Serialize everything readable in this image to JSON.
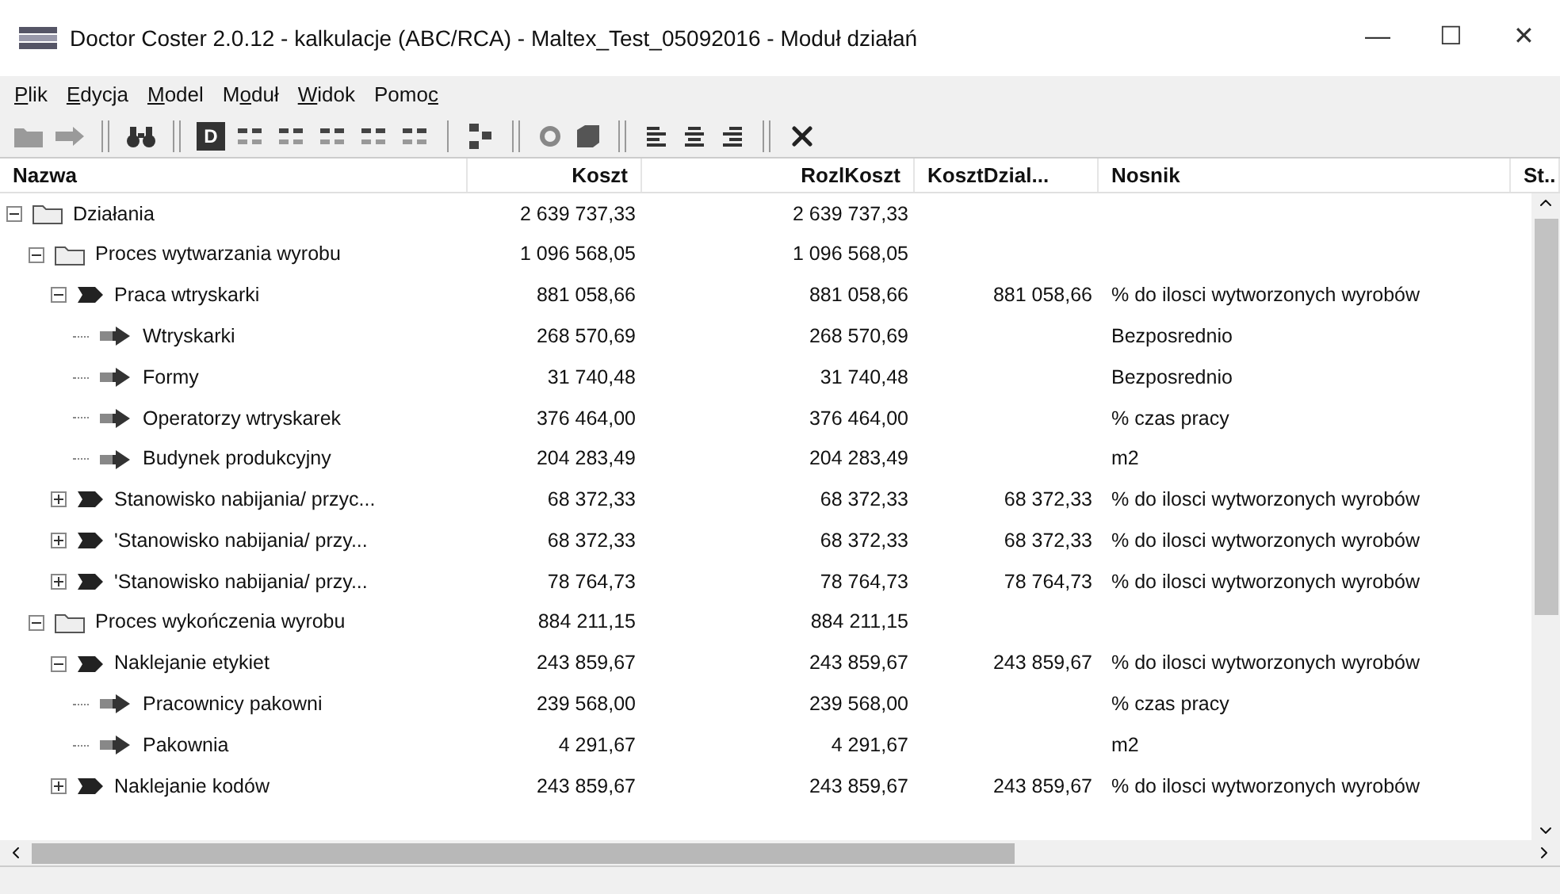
{
  "window": {
    "title": "Doctor Coster 2.0.12 - kalkulacje (ABC/RCA) - Maltex_Test_05092016 - Moduł działań",
    "buttons": [
      "—",
      "☐",
      "✕"
    ]
  },
  "menu": [
    {
      "key": "P",
      "post": "lik"
    },
    {
      "key": "E",
      "post": "dycja"
    },
    {
      "key": "M",
      "post": "odel"
    },
    {
      "pre": "M",
      "key": "o",
      "post": "duł"
    },
    {
      "key": "W",
      "post": "idok"
    },
    {
      "pre": "Pomo",
      "key": "c"
    }
  ],
  "toolbar": [
    {
      "kind": "folder",
      "disabled": true
    },
    {
      "kind": "arrow",
      "disabled": true
    },
    {
      "kind": "sep"
    },
    {
      "kind": "binoculars",
      "disabled": false
    },
    {
      "kind": "sep"
    },
    {
      "kind": "letter",
      "label": "D"
    },
    {
      "kind": "grid"
    },
    {
      "kind": "grid"
    },
    {
      "kind": "grid"
    },
    {
      "kind": "grid"
    },
    {
      "kind": "grid"
    },
    {
      "kind": "sep1"
    },
    {
      "kind": "tree"
    },
    {
      "kind": "sep"
    },
    {
      "kind": "gear"
    },
    {
      "kind": "cube"
    },
    {
      "kind": "sep"
    },
    {
      "kind": "align-left"
    },
    {
      "kind": "align-center"
    },
    {
      "kind": "align-right"
    },
    {
      "kind": "sep"
    },
    {
      "kind": "delete"
    }
  ],
  "table": {
    "columns": [
      "Nazwa",
      "Koszt",
      "RozlKoszt",
      "KosztDzial...",
      "Nosnik",
      "St.."
    ],
    "rows": [
      {
        "kind": "folder",
        "expanded": true,
        "name": "Działania",
        "koszt": "2 639 737,33",
        "rozl": "2 639 737,33",
        "children": [
          {
            "kind": "folder",
            "expanded": true,
            "name": "Proces wytwarzania wyrobu",
            "koszt": "1 096 568,05",
            "rozl": "1 096 568,05",
            "children": [
              {
                "kind": "activity",
                "expanded": true,
                "name": "Praca wtryskarki",
                "koszt": "881 058,66",
                "rozl": "881 058,66",
                "dzial": "881 058,66",
                "nosnik": "% do ilosci wytworzonych wyrobów",
                "children": [
                  {
                    "kind": "resource",
                    "name": "Wtryskarki",
                    "koszt": "268 570,69",
                    "rozl": "268 570,69",
                    "nosnik": "Bezposrednio"
                  },
                  {
                    "kind": "resource",
                    "name": "Formy",
                    "koszt": "31 740,48",
                    "rozl": "31 740,48",
                    "nosnik": "Bezposrednio"
                  },
                  {
                    "kind": "resource",
                    "name": "Operatorzy wtryskarek",
                    "koszt": "376 464,00",
                    "rozl": "376 464,00",
                    "nosnik": "% czas pracy"
                  },
                  {
                    "kind": "resource",
                    "name": "Budynek produkcyjny",
                    "koszt": "204 283,49",
                    "rozl": "204 283,49",
                    "nosnik": "m2"
                  }
                ]
              },
              {
                "kind": "activity",
                "expanded": false,
                "name": "Stanowisko nabijania/ przyc...",
                "koszt": "68 372,33",
                "rozl": "68 372,33",
                "dzial": "68 372,33",
                "nosnik": "% do ilosci wytworzonych wyrobów"
              },
              {
                "kind": "activity",
                "expanded": false,
                "name": "'Stanowisko nabijania/ przy...",
                "koszt": "68 372,33",
                "rozl": "68 372,33",
                "dzial": "68 372,33",
                "nosnik": "% do ilosci wytworzonych wyrobów"
              },
              {
                "kind": "activity",
                "expanded": false,
                "name": "'Stanowisko nabijania/ przy...",
                "koszt": "78 764,73",
                "rozl": "78 764,73",
                "dzial": "78 764,73",
                "nosnik": "% do ilosci wytworzonych wyrobów"
              }
            ]
          },
          {
            "kind": "folder",
            "expanded": true,
            "name": "Proces wykończenia wyrobu",
            "koszt": "884 211,15",
            "rozl": "884 211,15",
            "children": [
              {
                "kind": "activity",
                "expanded": true,
                "name": "Naklejanie etykiet",
                "koszt": "243 859,67",
                "rozl": "243 859,67",
                "dzial": "243 859,67",
                "nosnik": "% do ilosci wytworzonych wyrobów",
                "children": [
                  {
                    "kind": "resource",
                    "name": "Pracownicy pakowni",
                    "koszt": "239 568,00",
                    "rozl": "239 568,00",
                    "nosnik": "% czas pracy"
                  },
                  {
                    "kind": "resource",
                    "name": "Pakownia",
                    "koszt": "4 291,67",
                    "rozl": "4 291,67",
                    "nosnik": "m2"
                  }
                ]
              },
              {
                "kind": "activity",
                "expanded": false,
                "name": "Naklejanie kodów",
                "koszt": "243 859,67",
                "rozl": "243 859,67",
                "dzial": "243 859,67",
                "nosnik": "% do ilosci wytworzonych wyrobów"
              }
            ]
          }
        ]
      }
    ]
  }
}
